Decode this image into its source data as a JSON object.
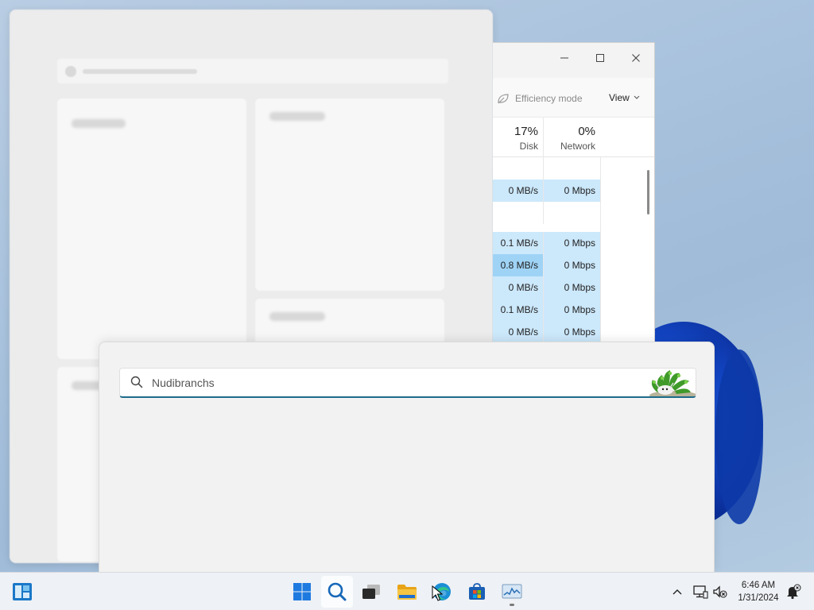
{
  "desktop": {
    "accent_color": "#1448c9"
  },
  "task_manager": {
    "toolbar": {
      "efficiency_label": "Efficiency mode",
      "view_label": "View"
    },
    "columns": [
      {
        "percent": "17%",
        "label": "Disk"
      },
      {
        "percent": "0%",
        "label": "Network"
      }
    ],
    "rows": [
      {
        "disk": "",
        "network": "",
        "highlight": false
      },
      {
        "disk": "0 MB/s",
        "network": "0 Mbps",
        "highlight": true
      },
      {
        "disk": "",
        "network": "",
        "highlight": false
      },
      {
        "disk": "0.1 MB/s",
        "network": "0 Mbps",
        "highlight": true
      },
      {
        "disk": "0.8 MB/s",
        "network": "0 Mbps",
        "highlight": true,
        "strong": true
      },
      {
        "disk": "0 MB/s",
        "network": "0 Mbps",
        "highlight": true
      },
      {
        "disk": "0.1 MB/s",
        "network": "0 Mbps",
        "highlight": true
      },
      {
        "disk": "0 MB/s",
        "network": "0 Mbps",
        "highlight": true
      }
    ]
  },
  "search": {
    "query": "",
    "placeholder": "Nudibranchs",
    "accent_color": "#1d6b8a"
  },
  "taskbar": {
    "icons": [
      "widgets-icon",
      "search-icon",
      "task-view-icon",
      "file-explorer-icon",
      "edge-icon",
      "store-icon",
      "task-manager-icon"
    ],
    "clock": {
      "time": "6:46 AM",
      "date": "1/31/2024"
    }
  }
}
